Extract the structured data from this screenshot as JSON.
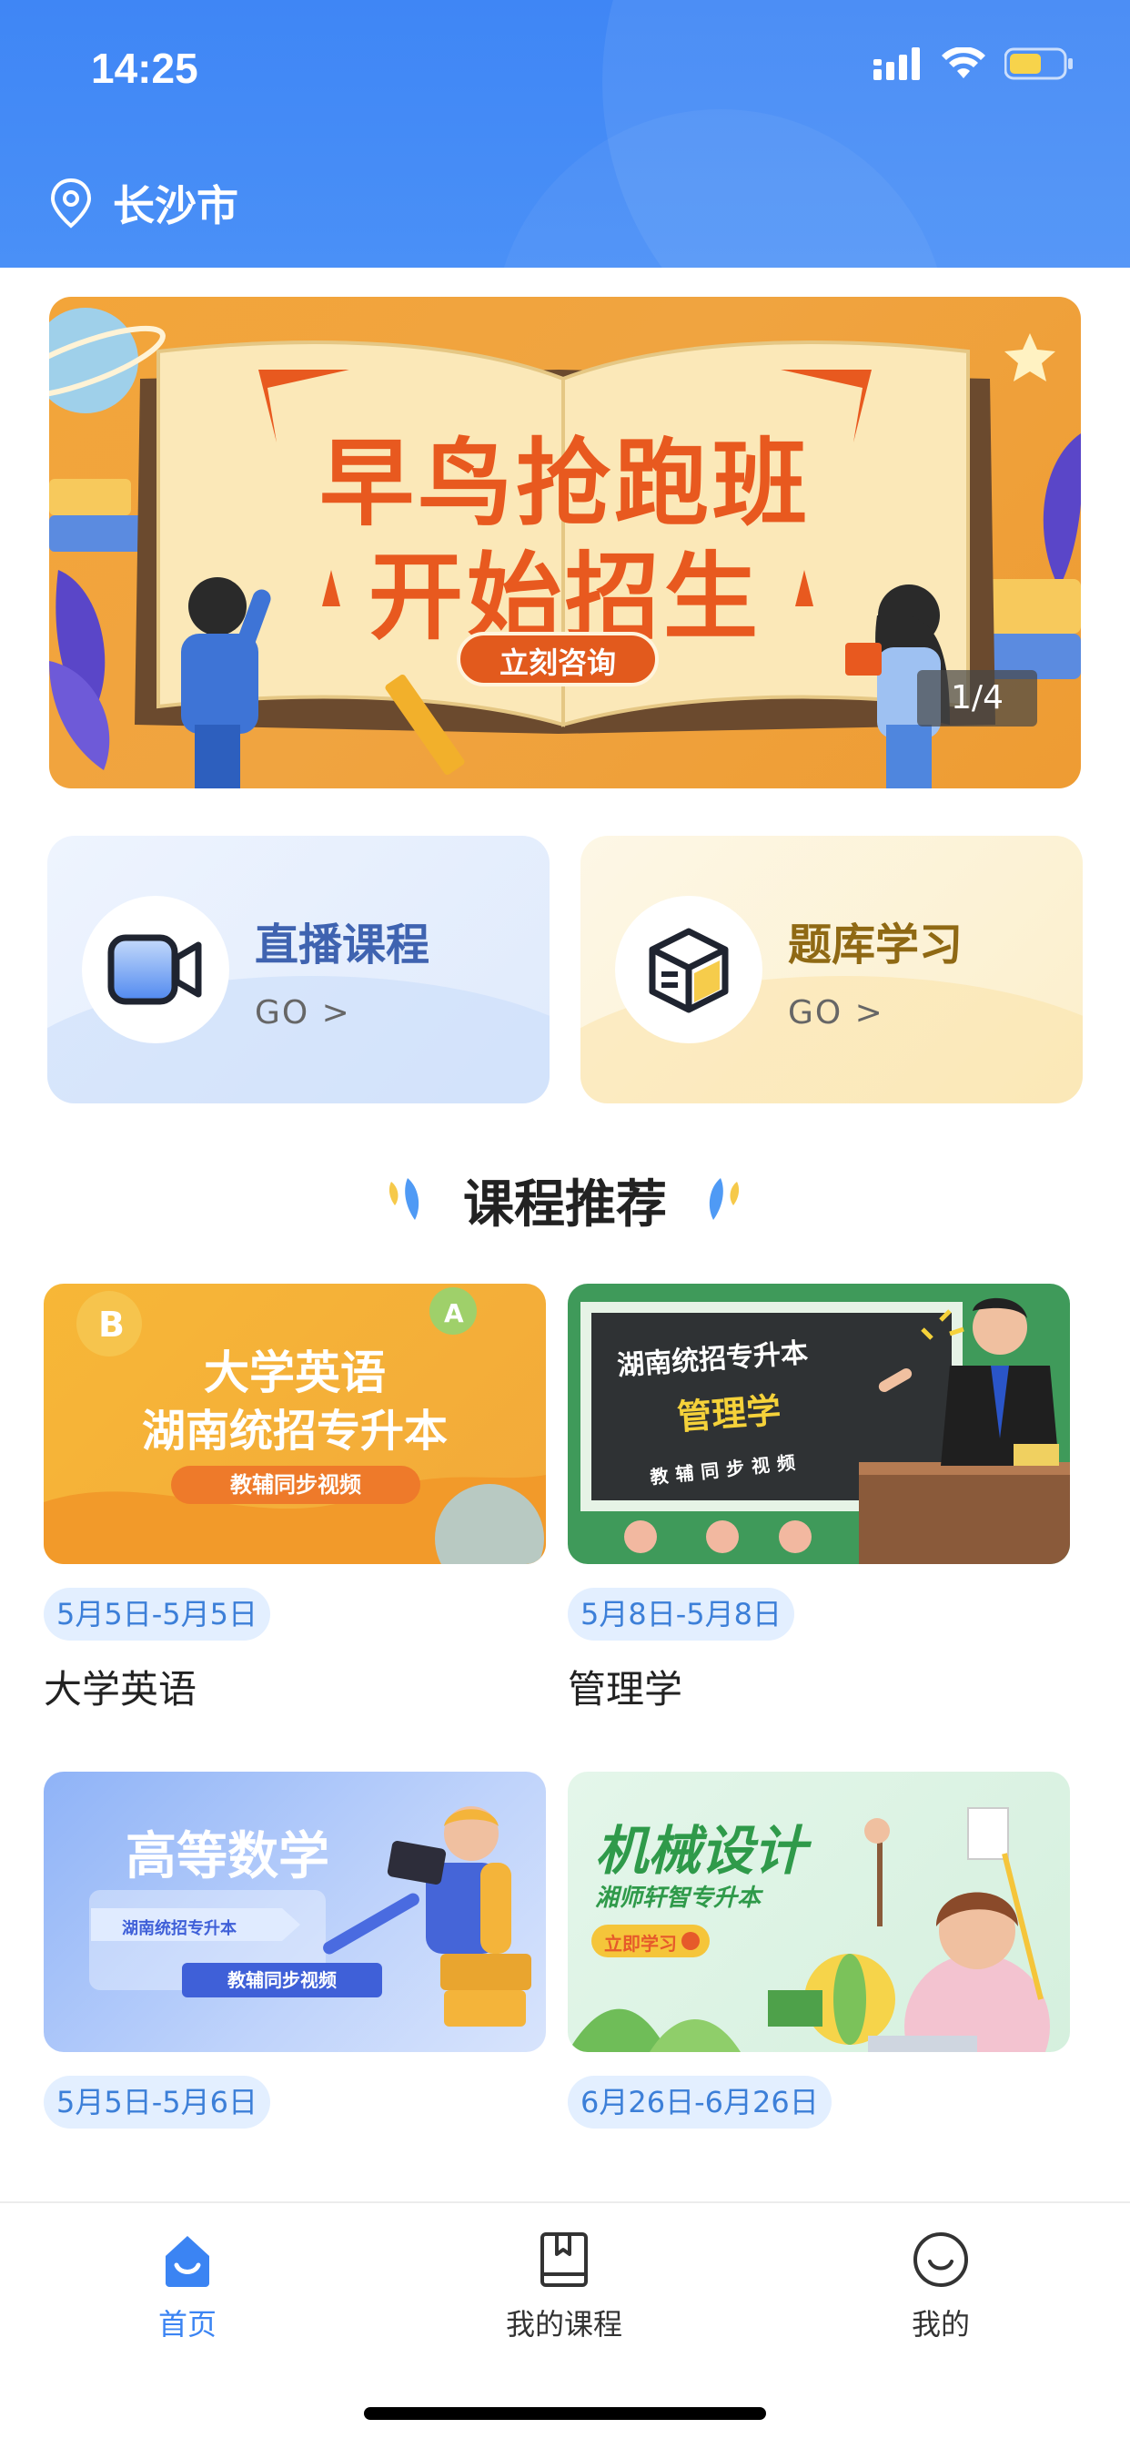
{
  "status_bar": {
    "time": "14:25"
  },
  "header": {
    "location": "长沙市"
  },
  "banner": {
    "line1": "早鸟抢跑班",
    "line2": "开始招生",
    "cta": "立刻咨询",
    "counter": "1/4"
  },
  "entries": [
    {
      "title": "直播课程",
      "go": "GO >"
    },
    {
      "title": "题库学习",
      "go": "GO >"
    }
  ],
  "section": {
    "title": "课程推荐"
  },
  "courses": [
    {
      "thumb_line1": "大学英语",
      "thumb_line2": "湖南统招专升本",
      "thumb_tag": "教辅同步视频",
      "date": "5月5日-5月5日",
      "name": "大学英语"
    },
    {
      "thumb_line1": "湖南统招专升本",
      "thumb_line2": "管理学",
      "thumb_tag": "教辅同步视频",
      "date": "5月8日-5月8日",
      "name": "管理学"
    },
    {
      "thumb_line1": "高等数学",
      "thumb_line2": "湖南统招专升本",
      "thumb_tag": "教辅同步视频",
      "date": "5月5日-5月6日",
      "name": ""
    },
    {
      "thumb_line1": "机械设计",
      "thumb_line2": "湘师轩智专升本",
      "thumb_tag": "立即学习",
      "date": "6月26日-6月26日",
      "name": ""
    }
  ],
  "tabbar": [
    {
      "label": "首页",
      "icon": "home-icon",
      "active": true
    },
    {
      "label": "我的课程",
      "icon": "book-icon",
      "active": false
    },
    {
      "label": "我的",
      "icon": "smile-icon",
      "active": false
    }
  ],
  "colors": {
    "primary": "#3b84f3",
    "banner_orange": "#f0a440",
    "accent_red": "#e8591f"
  }
}
